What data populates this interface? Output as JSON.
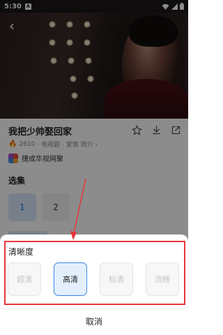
{
  "status_bar": {
    "time": "5:30",
    "notification_icon": "A",
    "icons": [
      "wifi-icon",
      "signal-icon",
      "battery-icon"
    ]
  },
  "video": {
    "back_icon": "‹"
  },
  "program": {
    "title": "我把少帅娶回家",
    "views": "2610",
    "meta_text": "· 电视剧 · 爱情",
    "intro_label": "简介 ›",
    "provider": "捷成华视网聚",
    "actions": [
      "star-icon",
      "download-icon",
      "share-icon"
    ]
  },
  "episodes": {
    "title": "选集",
    "items": [
      "1",
      "2"
    ],
    "active_index": 0
  },
  "quality_sheet": {
    "title": "清晰度",
    "options": [
      "超清",
      "高清",
      "标清",
      "流畅"
    ],
    "selected_index": 1,
    "cancel_label": "取消"
  },
  "colors": {
    "accent": "#3b87e6",
    "annotation_red": "#e8353b",
    "hot": "#f0642a"
  }
}
